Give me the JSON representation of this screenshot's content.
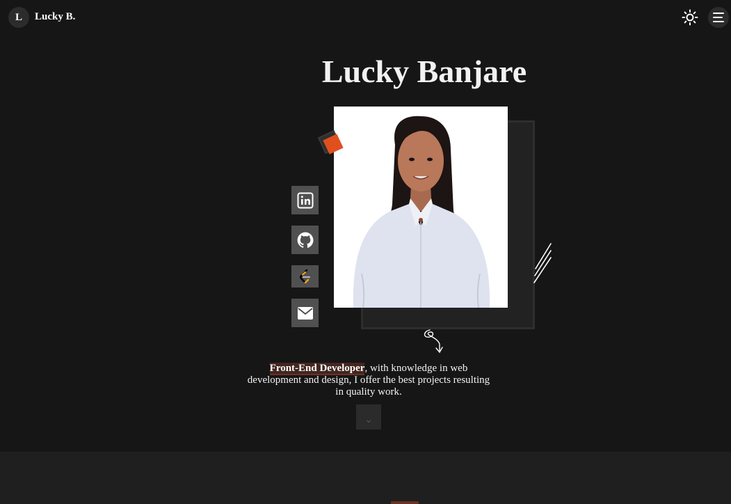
{
  "header": {
    "logo_initial": "L",
    "logo_name": "Lucky B."
  },
  "hero": {
    "name": "Lucky Banjare",
    "intro_highlight": "Front-End Developer",
    "intro_rest": ", with knowledge in web development and design, I offer the best projects resulting in quality work."
  },
  "social": [
    {
      "icon": "linkedin-icon"
    },
    {
      "icon": "github-icon"
    },
    {
      "icon": "leetcode-icon"
    },
    {
      "icon": "mail-icon"
    }
  ],
  "colors": {
    "background": "#161616",
    "accent": "#e0501f",
    "social_bg": "#505050",
    "highlight_bg": "#43261f"
  }
}
